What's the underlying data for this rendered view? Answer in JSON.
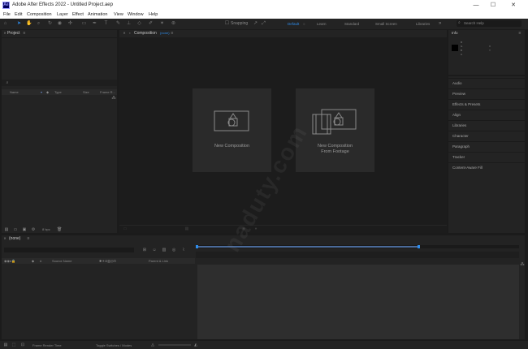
{
  "app": {
    "title": "Adobe After Effects 2022 - Untitled Project.aep",
    "logo": "Ae"
  },
  "window_controls": {
    "minimize": "—",
    "maximize": "☐",
    "close": "✕"
  },
  "menu": [
    "File",
    "Edit",
    "Composition",
    "Layer",
    "Effect",
    "Animation",
    "View",
    "Window",
    "Help"
  ],
  "toolbar": {
    "snapping_label": "Snapping",
    "workspaces": [
      "Default",
      "Learn",
      "Standard",
      "Small Screen",
      "Libraries"
    ],
    "active_workspace": "Default",
    "overflow": "»",
    "search_placeholder": "Search Help"
  },
  "project_panel": {
    "tab": "Project",
    "columns": [
      "Name",
      "Type",
      "Size",
      "Frame R..."
    ],
    "footer_bpc": "8 bpc"
  },
  "composition_panel": {
    "tab": "Composition",
    "tab_suffix": "(none)",
    "tiles": [
      {
        "label": "New Composition",
        "icon": "new-composition-icon"
      },
      {
        "label": "New Composition\nFrom Footage",
        "icon": "composition-from-footage-icon"
      }
    ]
  },
  "info_panel": {
    "tab": "Info",
    "readout": [
      "R",
      "G",
      "B",
      "A",
      "X",
      "Y"
    ]
  },
  "right_panels": [
    "Audio",
    "Preview",
    "Effects & Presets",
    "Align",
    "Libraries",
    "Character",
    "Paragraph",
    "Tracker",
    "Content-Aware Fill"
  ],
  "timeline_panel": {
    "tab": "(none)",
    "layer_name_header": "Source Name",
    "parent_header": "Parent & Link"
  },
  "footer": {
    "frame_render_time": "Frame Render Time",
    "toggle": "Toggle Switches / Modes"
  },
  "watermark": "naduty.com",
  "colors": {
    "accent": "#2d8ceb",
    "panel": "#232323",
    "background": "#1b1b1b"
  }
}
